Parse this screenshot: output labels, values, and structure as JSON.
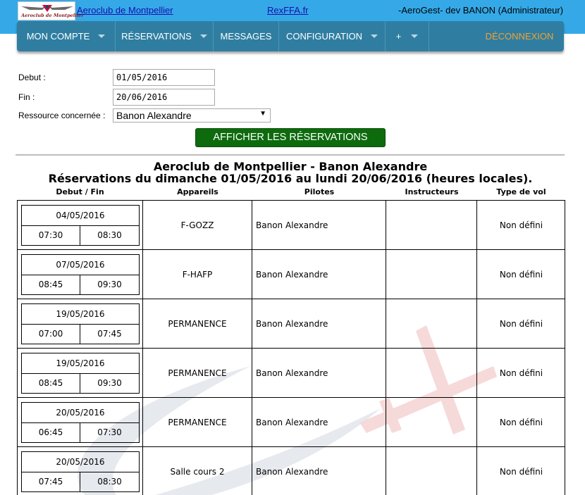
{
  "header": {
    "logo_text": "Aeroclub de Montpellier",
    "club_link": "Aeroclub de Montpellier",
    "rex_link": "RexFFA.fr",
    "app_info": "-AeroGest- dev BANON (Administrateur)"
  },
  "nav": {
    "items": [
      {
        "label": "MON COMPTE"
      },
      {
        "label": "RÉSERVATIONS"
      },
      {
        "label": "MESSAGES"
      },
      {
        "label": "CONFIGURATION"
      },
      {
        "label": "+"
      }
    ],
    "logout": "DÉCONNEXION"
  },
  "form": {
    "debut_label": "Debut :",
    "debut_value": "01/05/2016",
    "fin_label": "Fin :",
    "fin_value": "20/06/2016",
    "resource_label": "Ressource concernée :",
    "resource_value": "Banon Alexandre",
    "submit_label": "AFFICHER LES RÉSERVATIONS"
  },
  "report": {
    "title": "Aeroclub de Montpellier - Banon Alexandre",
    "subtitle": "Réservations du dimanche 01/05/2016 au lundi 20/06/2016 (heures locales).",
    "columns": [
      "Debut / Fin",
      "Appareils",
      "Pilotes",
      "Instructeurs",
      "Type de vol"
    ],
    "rows": [
      {
        "date": "04/05/2016",
        "start": "07:30",
        "end": "08:30",
        "appareil": "F-GOZZ",
        "pilote": "Banon Alexandre",
        "instructeur": "",
        "type": "Non défini"
      },
      {
        "date": "07/05/2016",
        "start": "08:45",
        "end": "09:30",
        "appareil": "F-HAFP",
        "pilote": "Banon Alexandre",
        "instructeur": "",
        "type": "Non défini"
      },
      {
        "date": "19/05/2016",
        "start": "07:00",
        "end": "07:45",
        "appareil": "PERMANENCE",
        "pilote": "Banon Alexandre",
        "instructeur": "",
        "type": "Non défini"
      },
      {
        "date": "19/05/2016",
        "start": "08:45",
        "end": "09:30",
        "appareil": "PERMANENCE",
        "pilote": "Banon Alexandre",
        "instructeur": "",
        "type": "Non défini"
      },
      {
        "date": "20/05/2016",
        "start": "06:45",
        "end": "07:30",
        "appareil": "PERMANENCE",
        "pilote": "Banon Alexandre",
        "instructeur": "",
        "type": "Non défini"
      },
      {
        "date": "20/05/2016",
        "start": "07:45",
        "end": "08:30",
        "appareil": "Salle cours 2",
        "pilote": "Banon Alexandre",
        "instructeur": "",
        "type": "Non défini"
      }
    ]
  },
  "colors": {
    "topbar": "#35a9e8",
    "nav": "#2f7ea1",
    "logout": "#f5a033",
    "button": "#0d6b0d"
  },
  "icons": {
    "logo": "aeroclub-wings-logo",
    "nav_caret": "caret-down-icon",
    "select_arrow": "dropdown-arrow-icon",
    "watermark": "airplane-watermark"
  }
}
